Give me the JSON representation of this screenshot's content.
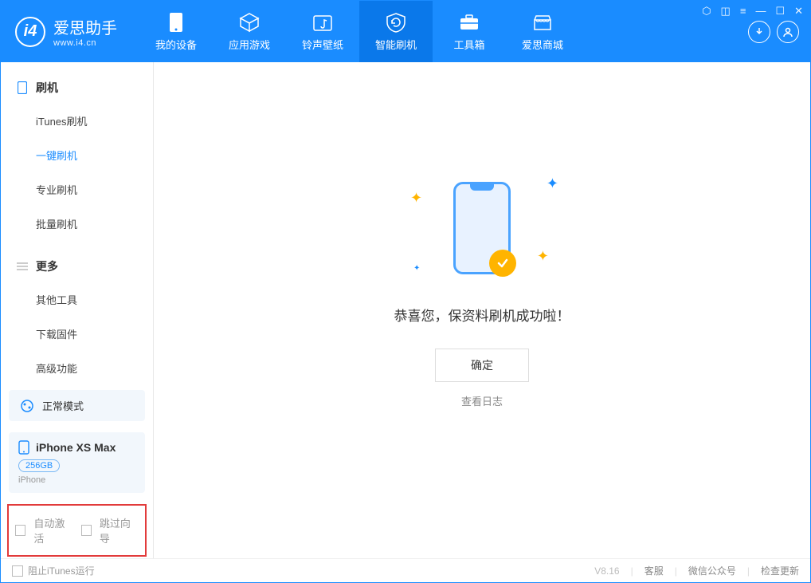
{
  "brand": {
    "name": "爱思助手",
    "url": "www.i4.cn"
  },
  "tabs": [
    {
      "label": "我的设备"
    },
    {
      "label": "应用游戏"
    },
    {
      "label": "铃声壁纸"
    },
    {
      "label": "智能刷机"
    },
    {
      "label": "工具箱"
    },
    {
      "label": "爱思商城"
    }
  ],
  "sidebar": {
    "s1": {
      "title": "刷机",
      "items": [
        "iTunes刷机",
        "一键刷机",
        "专业刷机",
        "批量刷机"
      ]
    },
    "s2": {
      "title": "更多",
      "items": [
        "其他工具",
        "下载固件",
        "高级功能"
      ]
    }
  },
  "mode": "正常模式",
  "device": {
    "name": "iPhone XS Max",
    "storage": "256GB",
    "type": "iPhone"
  },
  "opts": {
    "a": "自动激活",
    "b": "跳过向导"
  },
  "content": {
    "message": "恭喜您，保资料刷机成功啦！",
    "ok": "确定",
    "log": "查看日志"
  },
  "footer": {
    "stop": "阻止iTunes运行",
    "version": "V8.16",
    "l1": "客服",
    "l2": "微信公众号",
    "l3": "检查更新"
  }
}
